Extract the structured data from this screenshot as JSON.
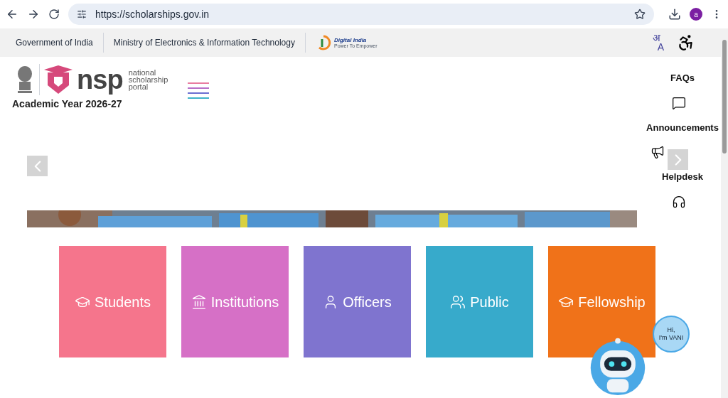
{
  "browser": {
    "url": "https://scholarships.gov.in",
    "profile_initial": "a"
  },
  "gov_bar": {
    "links": [
      "Government of India",
      "Ministry of Electronics & Information Technology"
    ],
    "logo_text": "Digital India",
    "logo_tagline": "Power To Empower",
    "language_letters": [
      "अ",
      "A"
    ]
  },
  "header": {
    "logo_name": "nsp",
    "logo_caption": [
      "national",
      "scholarship",
      "portal"
    ],
    "academic_year": "Academic Year 2026-27"
  },
  "side_links": [
    {
      "label": "FAQs",
      "kind": "chat"
    },
    {
      "label": "Announcements",
      "kind": "megaphone"
    },
    {
      "label": "Helpdesk",
      "kind": "headset"
    }
  ],
  "tiles": [
    {
      "label": "Students",
      "kind": "cap",
      "color": "#f5758c"
    },
    {
      "label": "Institutions",
      "kind": "bank",
      "color": "#d670c6"
    },
    {
      "label": "Officers",
      "kind": "person",
      "color": "#7f74cf"
    },
    {
      "label": "Public",
      "kind": "people",
      "color": "#37aacb"
    },
    {
      "label": "Fellowship",
      "kind": "cap",
      "color": "#f07219"
    }
  ],
  "chatbot": {
    "greeting": "Hi,",
    "name": "I'm VANI"
  }
}
